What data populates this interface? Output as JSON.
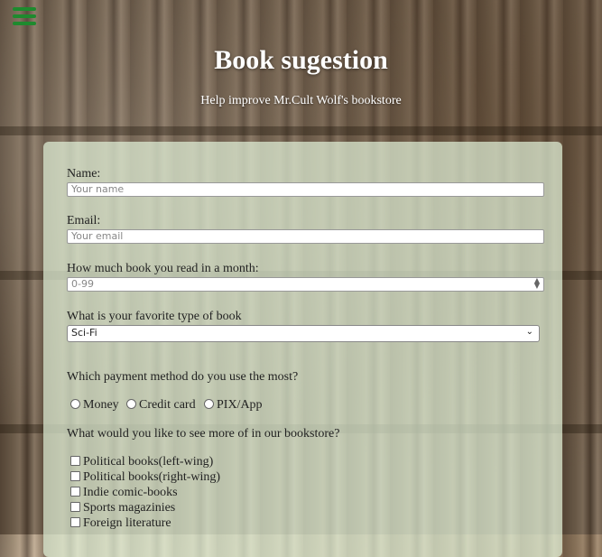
{
  "header": {
    "title": "Book sugestion",
    "subtitle": "Help improve Mr.Cult Wolf's bookstore",
    "menu_icon": "hamburger-menu-icon",
    "menu_color": "#1e8a2e"
  },
  "form": {
    "name_label": "Name:",
    "name_placeholder": "Your name",
    "email_label": "Email:",
    "email_placeholder": "Your email",
    "books_label": "How much book you read in a month:",
    "books_placeholder": "0-99",
    "type_label": "What is your favorite type of book",
    "type_selected": "Sci-Fi",
    "payment_label": "Which payment method do you use the most?",
    "payment_options": [
      "Money",
      "Credit card",
      "PIX/App"
    ],
    "more_label": "What would you like to see more of in our bookstore?",
    "more_options": [
      "Political books(left-wing)",
      "Political books(right-wing)",
      "Indie comic-books",
      "Sports magazinies",
      "Foreign literature"
    ]
  }
}
